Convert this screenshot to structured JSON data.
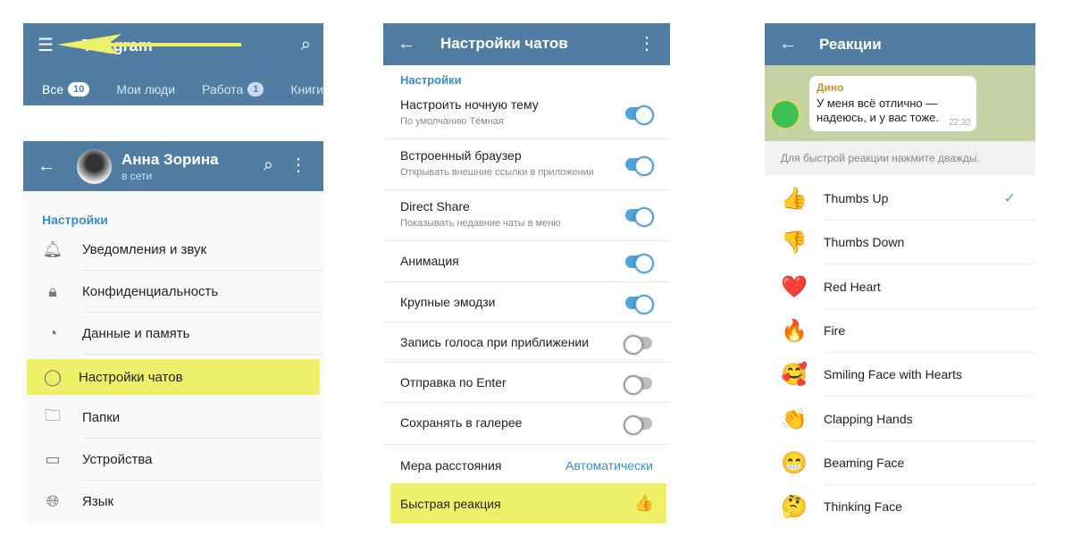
{
  "panel1": {
    "app_title": "Telegram",
    "tabs": [
      {
        "label": "Все",
        "badge": "10"
      },
      {
        "label": "Мои люди"
      },
      {
        "label": "Работа",
        "badge": "1"
      },
      {
        "label": "Книги"
      }
    ]
  },
  "panel2": {
    "name": "Анна Зорина",
    "status": "в сети",
    "section": "Настройки",
    "items": [
      {
        "label": "Уведомления и звук",
        "icon": "bell-icon"
      },
      {
        "label": "Конфиденциальность",
        "icon": "lock-icon"
      },
      {
        "label": "Данные и память",
        "icon": "pie-chart-icon"
      },
      {
        "label": "Настройки чатов",
        "icon": "chat-bubble-icon",
        "highlighted": true
      },
      {
        "label": "Папки",
        "icon": "folder-icon"
      },
      {
        "label": "Устройства",
        "icon": "devices-icon"
      },
      {
        "label": "Язык",
        "icon": "globe-icon"
      }
    ]
  },
  "panel3": {
    "title": "Настройки чатов",
    "section": "Настройки",
    "items": [
      {
        "title": "Настроить ночную тему",
        "sub": "По умолчанию Тёмная",
        "toggle": true
      },
      {
        "title": "Встроенный браузер",
        "sub": "Открывать внешние ссылки в приложении",
        "toggle": true
      },
      {
        "title": "Direct Share",
        "sub": "Показывать недавние чаты в меню",
        "toggle": true
      },
      {
        "title": "Анимация",
        "toggle": true
      },
      {
        "title": "Крупные эмодзи",
        "toggle": true
      },
      {
        "title": "Запись голоса при приближении",
        "toggle": false
      },
      {
        "title": "Отправка по Enter",
        "toggle": false
      },
      {
        "title": "Сохранять в галерее",
        "toggle": false
      }
    ],
    "distance": {
      "title": "Мера расстояния",
      "value": "Автоматически"
    },
    "quick": {
      "title": "Быстрая реакция",
      "value": "👍"
    },
    "accent": "#3a8cc7"
  },
  "panel4": {
    "title": "Реакции",
    "message": {
      "sender": "Дино",
      "line1": "У меня всё отлично —",
      "line2": "надеюсь, и у вас тоже.",
      "time": "22:32"
    },
    "hint": "Для быстрой реакции нажмите дважды.",
    "reactions": [
      {
        "emoji": "👍",
        "name": "Thumbs Up",
        "selected": true
      },
      {
        "emoji": "👎",
        "name": "Thumbs Down"
      },
      {
        "emoji": "❤️",
        "name": "Red Heart"
      },
      {
        "emoji": "🔥",
        "name": "Fire"
      },
      {
        "emoji": "🥰",
        "name": "Smiling Face with Hearts"
      },
      {
        "emoji": "👏",
        "name": "Clapping Hands"
      },
      {
        "emoji": "😁",
        "name": "Beaming Face"
      },
      {
        "emoji": "🤔",
        "name": "Thinking Face"
      }
    ]
  },
  "colors": {
    "header": "#517da2",
    "toggle_on": "#4ea4dc",
    "highlight": "#eef06a"
  }
}
